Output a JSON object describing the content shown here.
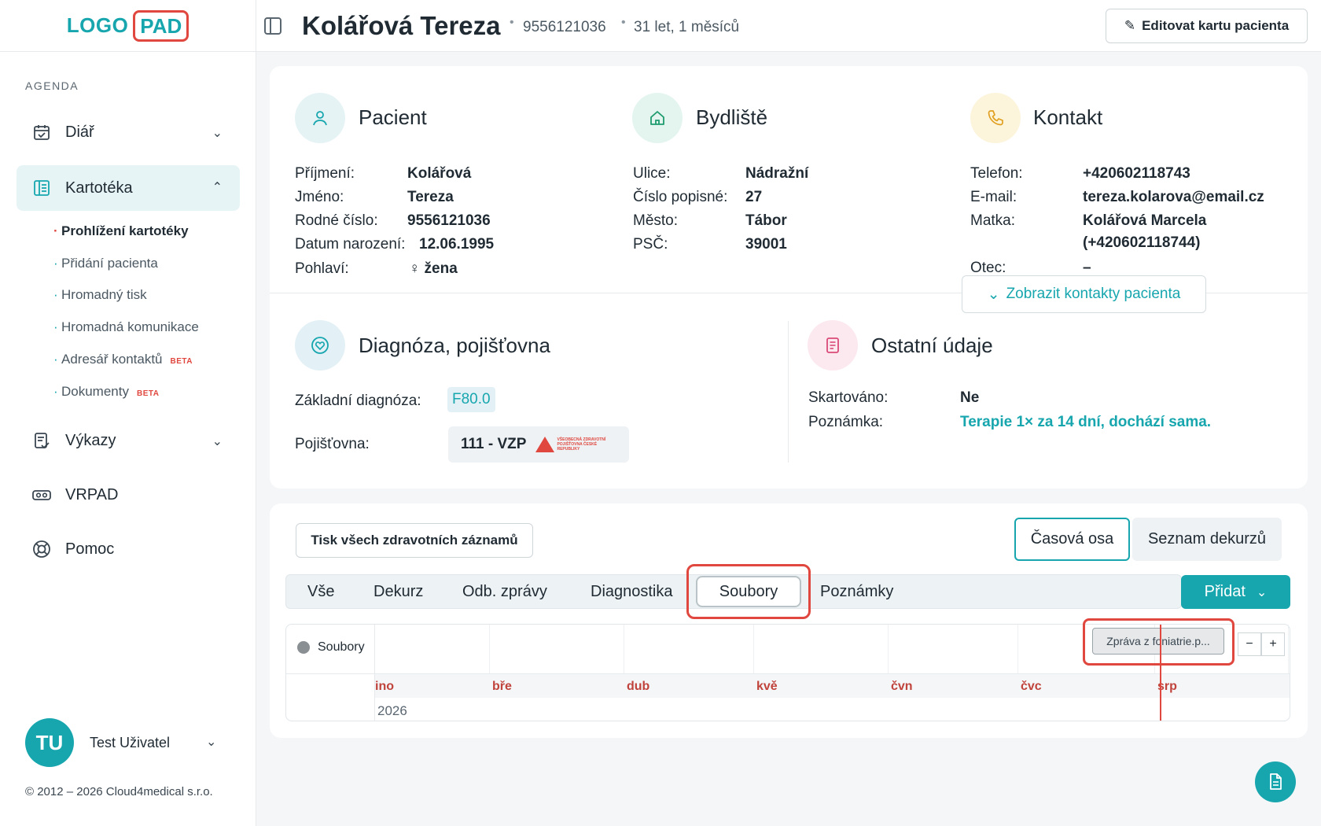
{
  "logo": {
    "part1": "LOGO",
    "part2": "PAD"
  },
  "sidebar": {
    "section": "AGENDA",
    "items": [
      {
        "label": "Diář",
        "icon": "calendar-icon"
      },
      {
        "label": "Kartotéka",
        "icon": "card-file-icon"
      },
      {
        "label": "Výkazy",
        "icon": "report-icon"
      },
      {
        "label": "VRPAD",
        "icon": "vr-headset-icon"
      },
      {
        "label": "Pomoc",
        "icon": "lifebuoy-icon"
      }
    ],
    "sub": [
      {
        "label": "Prohlížení kartotéky"
      },
      {
        "label": "Přidání pacienta"
      },
      {
        "label": "Hromadný tisk"
      },
      {
        "label": "Hromadná komunikace"
      },
      {
        "label": "Adresář kontaktů",
        "badge": "BETA"
      },
      {
        "label": "Dokumenty",
        "badge": "BETA"
      }
    ],
    "user": {
      "initials": "TU",
      "name": "Test Uživatel"
    },
    "copyright": "© 2012 – 2026 Cloud4medical s.r.o."
  },
  "header": {
    "name": "Kolářová Tereza",
    "id": "9556121036",
    "age": "31 let, 1 měsíců",
    "edit_label": "Editovat kartu pacienta"
  },
  "patient": {
    "title": "Pacient",
    "rows": [
      {
        "label": "Příjmení:",
        "value": "Kolářová"
      },
      {
        "label": "Jméno:",
        "value": "Tereza"
      },
      {
        "label": "Rodné číslo:",
        "value": "9556121036"
      },
      {
        "label": "Datum narození:",
        "value": "12.06.1995"
      },
      {
        "label": "Pohlaví:",
        "value": "žena",
        "icon": "female-icon"
      }
    ]
  },
  "address": {
    "title": "Bydliště",
    "rows": [
      {
        "label": "Ulice:",
        "value": "Nádražní"
      },
      {
        "label": "Číslo popisné:",
        "value": "27"
      },
      {
        "label": "Město:",
        "value": "Tábor"
      },
      {
        "label": "PSČ:",
        "value": "39001"
      }
    ]
  },
  "contact": {
    "title": "Kontakt",
    "rows": [
      {
        "label": "Telefon:",
        "value": "+420602118743"
      },
      {
        "label": "E-mail:",
        "value": "tereza.kolarova@email.cz"
      },
      {
        "label": "Matka:",
        "value": "Kolářová Marcela",
        "value2": "(+420602118744)"
      },
      {
        "label": "Otec:",
        "value": "–"
      }
    ],
    "show_contacts": "Zobrazit kontakty pacienta"
  },
  "diagnosis": {
    "title": "Diagnóza, pojišťovna",
    "diag_label": "Základní diagnóza:",
    "diag_value": "F80.0",
    "ins_label": "Pojišťovna:",
    "ins_value": "111 - VZP",
    "ins_logo_text": "VŠEOBECNÁ ZDRAVOTNÍ POJIŠŤOVNA ČESKÉ REPUBLIKY"
  },
  "other": {
    "title": "Ostatní údaje",
    "rows": [
      {
        "label": "Skartováno:",
        "value": "Ne"
      },
      {
        "label": "Poznámka:",
        "value": "Terapie 1× za 14 dní, dochází sama."
      }
    ]
  },
  "records": {
    "print_all": "Tisk všech zdravotních záznamů",
    "view_timeline": "Časová osa",
    "view_list": "Seznam dekurzů",
    "tabs": [
      "Vše",
      "Dekurz",
      "Odb. zprávy",
      "Diagnostika",
      "Soubory",
      "Poznámky"
    ],
    "active_tab": "Soubory",
    "add_label": "Přidat"
  },
  "timeline": {
    "row_label": "Soubory",
    "months": [
      "ino",
      "bře",
      "dub",
      "kvě",
      "čvn",
      "čvc",
      "srp"
    ],
    "year": "2026",
    "event": "Zpráva z foniatrie.p...",
    "zoom_out": "−",
    "zoom_in": "+"
  },
  "colors": {
    "accent": "#17a6ae",
    "highlight": "#e0473f"
  }
}
